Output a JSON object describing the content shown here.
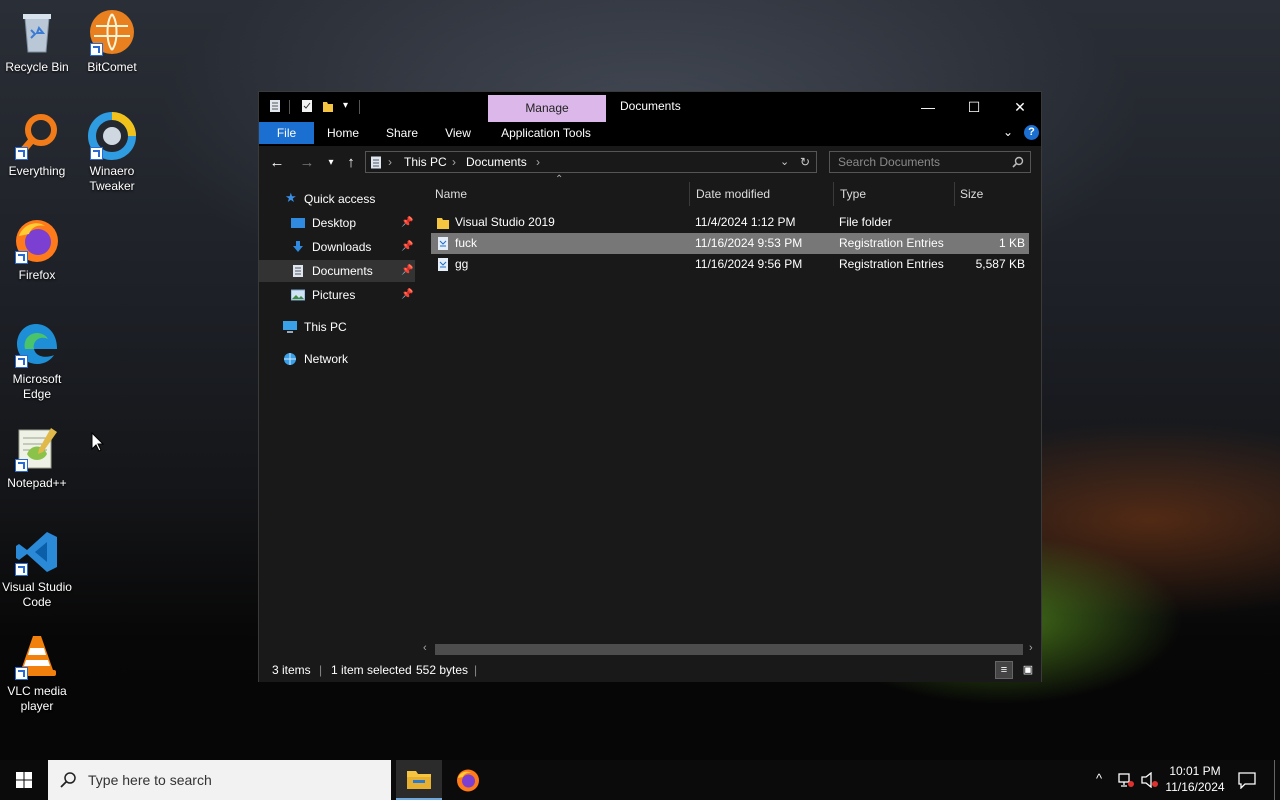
{
  "desktop": {
    "icons": [
      {
        "label": "Recycle Bin"
      },
      {
        "label": "BitComet"
      },
      {
        "label": "Everything"
      },
      {
        "label": "Winaero Tweaker"
      },
      {
        "label": "Firefox"
      },
      {
        "label": "Microsoft Edge"
      },
      {
        "label": "Notepad++"
      },
      {
        "label": "Visual Studio Code"
      },
      {
        "label": "VLC media player"
      }
    ]
  },
  "window": {
    "title": "Documents",
    "context_tab": "Manage",
    "ribbon_tabs": [
      "File",
      "Home",
      "Share",
      "View",
      "Application Tools"
    ],
    "controls": {
      "minimize": "—",
      "maximize": "☐",
      "close": "✕"
    },
    "address": {
      "segments": [
        "This PC",
        "Documents"
      ]
    },
    "search": {
      "placeholder": "Search Documents"
    },
    "nav": {
      "quick_access": "Quick access",
      "items": [
        {
          "label": "Desktop",
          "pinned": true
        },
        {
          "label": "Downloads",
          "pinned": true
        },
        {
          "label": "Documents",
          "pinned": true
        },
        {
          "label": "Pictures",
          "pinned": true
        }
      ],
      "this_pc": "This PC",
      "network": "Network"
    },
    "columns": [
      "Name",
      "Date modified",
      "Type",
      "Size"
    ],
    "files": [
      {
        "name": "Visual Studio 2019",
        "date": "11/4/2024 1:12 PM",
        "type": "File folder",
        "size": "",
        "selected": false
      },
      {
        "name": "fuck",
        "date": "11/16/2024 9:53 PM",
        "type": "Registration Entries",
        "size": "1 KB",
        "selected": true
      },
      {
        "name": "gg",
        "date": "11/16/2024 9:56 PM",
        "type": "Registration Entries",
        "size": "5,587 KB",
        "selected": false
      }
    ],
    "status": {
      "items": "3 items",
      "selected": "1 item selected",
      "bytes": "552 bytes"
    }
  },
  "taskbar": {
    "search_placeholder": "Type here to search",
    "time": "10:01 PM",
    "date": "11/16/2024"
  },
  "colors": {
    "file_tab": "#1a6fd0",
    "manage_tab": "#dcb8ea",
    "selected_row": "#777777"
  }
}
